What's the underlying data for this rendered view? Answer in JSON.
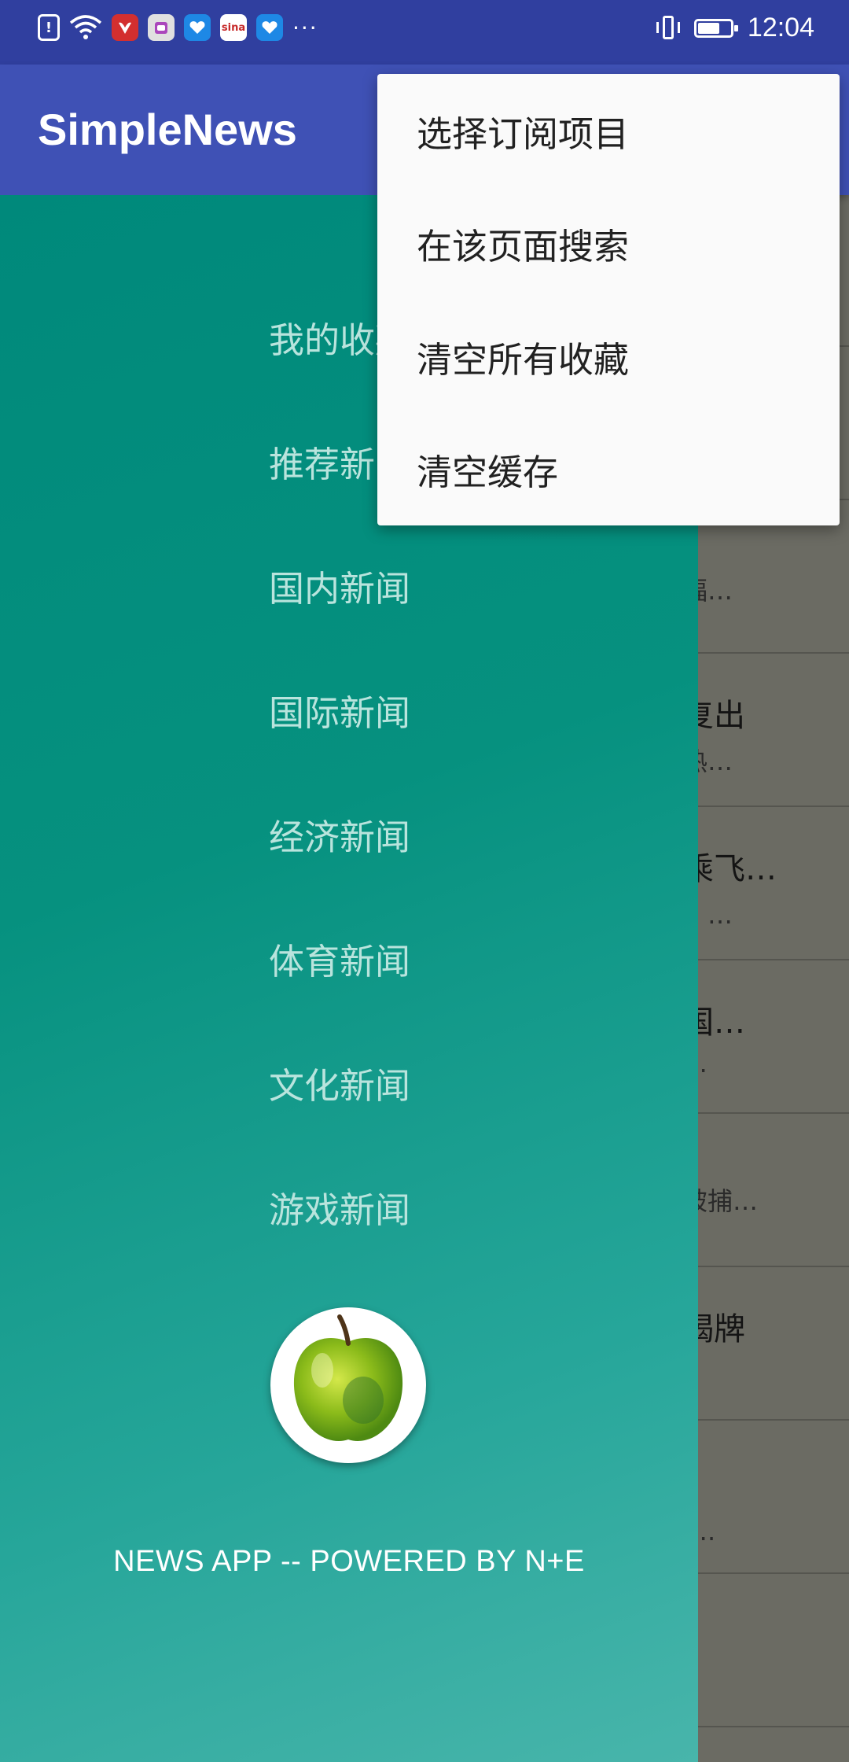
{
  "status_bar": {
    "time": "12:04",
    "left_icons": [
      "alert-icon",
      "wifi-icon",
      "huawei-app-icon",
      "store-app-icon",
      "health-app-icon",
      "sina-app-icon",
      "health-app-icon-2"
    ],
    "sina_label": "sina",
    "more": "···"
  },
  "app_bar": {
    "title": "SimpleNews"
  },
  "drawer": {
    "items": [
      "我的收藏",
      "推荐新闻",
      "国内新闻",
      "国际新闻",
      "经济新闻",
      "体育新闻",
      "文化新闻",
      "游戏新闻"
    ],
    "footer": "NEWS APP -- POWERED BY N+E",
    "colors": {
      "top": "#00897b",
      "bottom": "#48b5ab",
      "item_text": "#b9e4dd"
    }
  },
  "news_list": {
    "items": [
      {
        "title": "",
        "summary": ""
      },
      {
        "title": "",
        "summary": ""
      },
      {
        "title": "",
        "summary": "福…"
      },
      {
        "title": "复出",
        "summary": "热…"
      },
      {
        "title": "乘飞…",
        "summary": "，…"
      },
      {
        "title": "国…",
        "summary": "…"
      },
      {
        "title": "",
        "summary": "被捕…"
      },
      {
        "title": "揭牌",
        "summary": ""
      },
      {
        "title": "",
        "summary": "…."
      },
      {
        "title": "",
        "summary": ""
      }
    ]
  },
  "popup_menu": {
    "items": [
      "选择订阅项目",
      "在该页面搜索",
      "清空所有收藏",
      "清空缓存"
    ]
  },
  "colors": {
    "primary": "#3f51b5",
    "primary_dark": "#303f9f",
    "menu_bg": "#fafafa"
  }
}
